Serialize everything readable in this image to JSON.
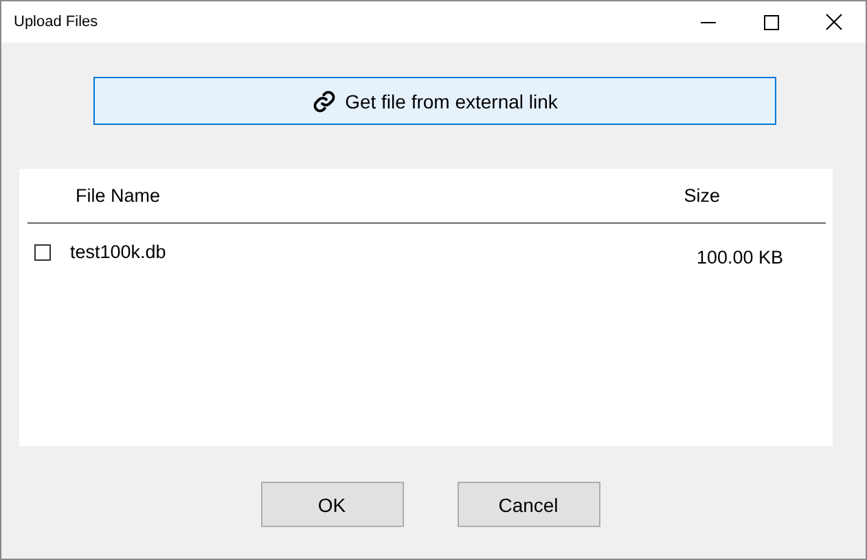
{
  "window": {
    "title": "Upload Files"
  },
  "link_button": {
    "label": "Get file from external link"
  },
  "table": {
    "columns": [
      "File Name",
      "Size"
    ],
    "rows": [
      {
        "name": "test100k.db",
        "size": "100.00 KB",
        "checked": false
      }
    ]
  },
  "buttons": [
    "OK",
    "Cancel"
  ]
}
